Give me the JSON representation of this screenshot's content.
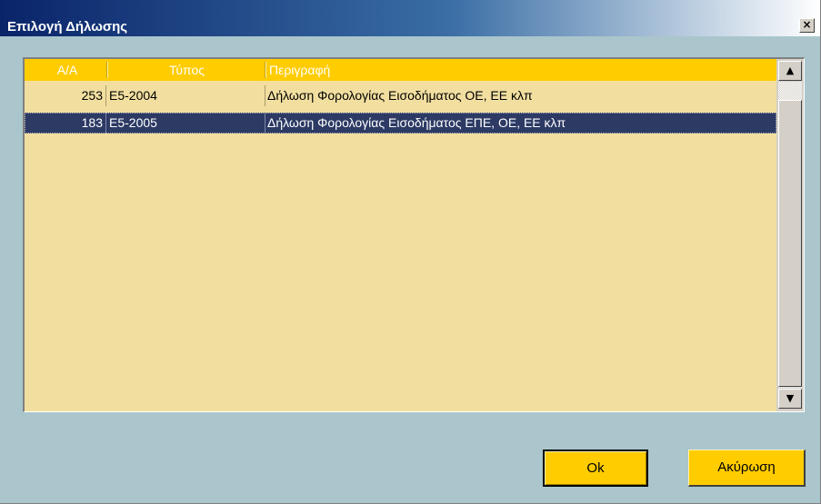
{
  "window": {
    "title": "Επιλογή Δήλωσης",
    "close_label": "×"
  },
  "table": {
    "columns": [
      "Α/Α",
      "Τύπος",
      "Περιγραφή"
    ],
    "rows": [
      {
        "aa": "253",
        "type": "E5-2004",
        "description": "Δήλωση Φορολογίας Εισοδήματος ΟΕ, ΕΕ κλπ",
        "selected": false
      },
      {
        "aa": "183",
        "type": "E5-2005",
        "description": "Δήλωση Φορολογίας Εισοδήματος ΕΠΕ, ΟΕ, ΕΕ κλπ",
        "selected": true
      }
    ]
  },
  "scrollbar": {
    "up_icon": "▲",
    "down_icon": "▼"
  },
  "buttons": {
    "ok_label": "Ok",
    "cancel_label": "Ακύρωση"
  },
  "colors": {
    "accent": "#ffcc00",
    "grid_background": "#f2dfa0",
    "selection": "#2c3a64",
    "dialog_background": "#aac6cc",
    "titlebar": "#0a246a"
  }
}
